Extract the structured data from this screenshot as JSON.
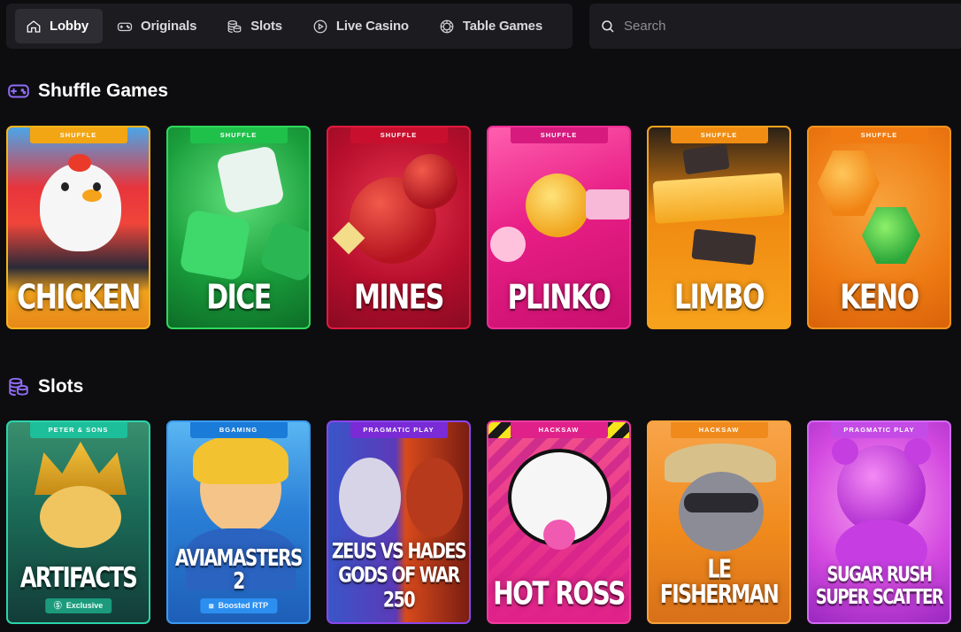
{
  "nav": {
    "items": [
      {
        "label": "Lobby",
        "icon": "home-icon",
        "active": true
      },
      {
        "label": "Originals",
        "icon": "gamepad-icon",
        "active": false
      },
      {
        "label": "Slots",
        "icon": "coins-icon",
        "active": false
      },
      {
        "label": "Live Casino",
        "icon": "play-circle-icon",
        "active": false
      },
      {
        "label": "Table Games",
        "icon": "chip-icon",
        "active": false
      }
    ]
  },
  "search": {
    "placeholder": "Search"
  },
  "sections": {
    "shuffle": {
      "title": "Shuffle Games",
      "icon": "gamepad-icon",
      "icon_color": "#8f6cf3",
      "cards": [
        {
          "name": "CHICKEN",
          "tag": "SHUFFLE",
          "tag_color": "#f2a614",
          "border": "#f5b41b"
        },
        {
          "name": "DICE",
          "tag": "SHUFFLE",
          "tag_color": "#1fc14a",
          "border": "#2fd95c"
        },
        {
          "name": "MINES",
          "tag": "SHUFFLE",
          "tag_color": "#c8102e",
          "border": "#e11a3e"
        },
        {
          "name": "PLINKO",
          "tag": "SHUFFLE",
          "tag_color": "#d61a7e",
          "border": "#f02d96"
        },
        {
          "name": "LIMBO",
          "tag": "SHUFFLE",
          "tag_color": "#f08d12",
          "border": "#f7a21c"
        },
        {
          "name": "KENO",
          "tag": "SHUFFLE",
          "tag_color": "#f07b12",
          "border": "#f5941d"
        }
      ]
    },
    "slots": {
      "title": "Slots",
      "icon": "coins-icon",
      "icon_color": "#8f6cf3",
      "cards": [
        {
          "name": "ARTIFACTS",
          "tag": "PETER & SONS",
          "tag_color": "#1dbf9a",
          "border": "#2ad4ab",
          "badge": "Exclusive",
          "badge_icon": "s-logo-icon"
        },
        {
          "name": "AVIAMASTERS 2",
          "tag": "BGAMING",
          "tag_color": "#1b7bd8",
          "border": "#3a9af0",
          "badge": "Boosted RTP",
          "badge_icon": "boost-icon"
        },
        {
          "name": "ZEUS VS HADES",
          "name2": "GODS OF WAR 250",
          "tag": "PRAGMATIC PLAY",
          "tag_color": "#7a2bd6",
          "border": "#8b45ec"
        },
        {
          "name": "HOT ROSS",
          "tag": "HACKSAW",
          "tag_color": "#e0218a",
          "border": "#f03aa0"
        },
        {
          "name": "LE FISHERMAN",
          "tag": "HACKSAW",
          "tag_color": "#f08a1c",
          "border": "#f7a23a"
        },
        {
          "name": "SUGAR RUSH",
          "name2": "SUPER SCATTER",
          "tag": "PRAGMATIC PLAY",
          "tag_color": "#c44be6",
          "border": "#d26af0"
        }
      ]
    }
  }
}
